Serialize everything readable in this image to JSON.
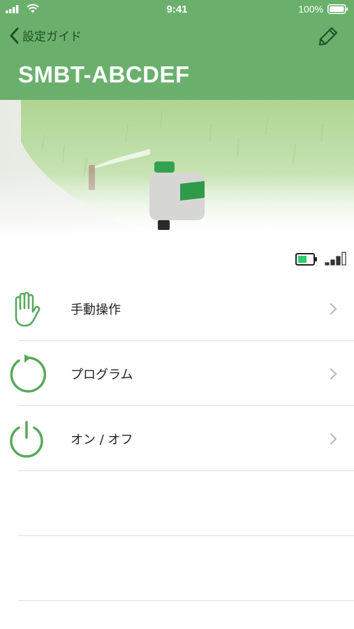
{
  "status_bar": {
    "time": "9:41",
    "battery_percent": "100%",
    "signal_icon": "cellular-signal-icon",
    "wifi_icon": "wifi-icon",
    "battery_icon": "battery-icon"
  },
  "nav": {
    "back_label": "設定ガイド",
    "back_icon": "chevron-left-icon",
    "edit_icon": "pencil-icon"
  },
  "device": {
    "title": "SMBT-ABCDEF",
    "battery_level": 0.6,
    "signal_bars": 3
  },
  "menu": {
    "items": [
      {
        "label": "手動操作",
        "icon": "hand-icon"
      },
      {
        "label": "プログラム",
        "icon": "circular-arrow-icon"
      },
      {
        "label": "オン / オフ",
        "icon": "power-icon"
      }
    ]
  },
  "colors": {
    "header_bg": "#6ab06c",
    "accent_green": "#5aa85c",
    "battery_fill": "#2ecc71",
    "divider": "#dcdcdc"
  }
}
